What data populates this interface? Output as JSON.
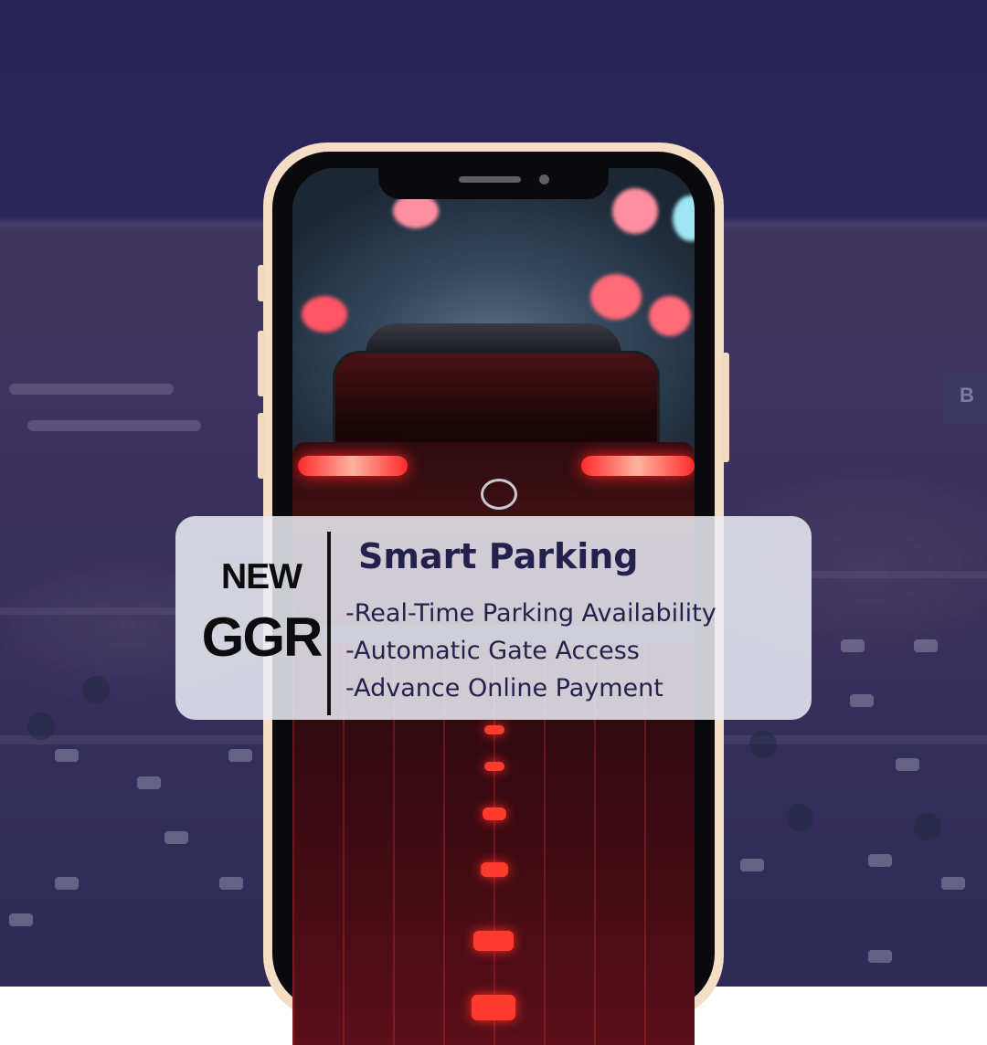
{
  "promo": {
    "badge_new": "NEW",
    "brand": "GGR",
    "title": "Smart Parking",
    "features": [
      "-Real-Time Parking Availability",
      "-Automatic Gate Access",
      "-Advance Online Payment"
    ]
  },
  "background": {
    "sign_text": "B"
  },
  "colors": {
    "background_overlay": "#2e2a5c",
    "phone_frame": "#f6ddc6",
    "card": "#ececf4",
    "title_text": "#24214f",
    "brand_text": "#0c0c0f",
    "tail_light": "#ff2a2a"
  },
  "icons": [
    "speaker-icon",
    "front-camera-icon"
  ]
}
